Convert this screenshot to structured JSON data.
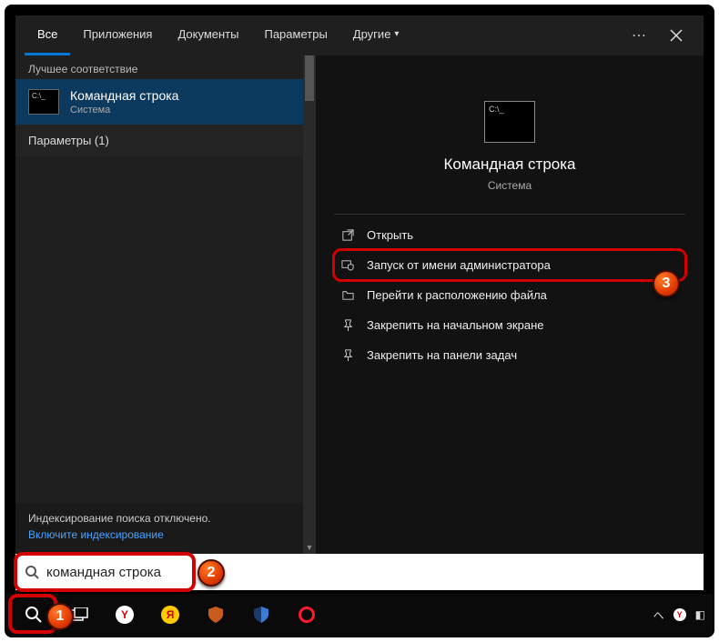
{
  "tabs": {
    "all": "Все",
    "apps": "Приложения",
    "docs": "Документы",
    "settings": "Параметры",
    "other": "Другие"
  },
  "left": {
    "best_match": "Лучшее соответствие",
    "result": {
      "title": "Командная строка",
      "sub": "Система"
    },
    "params": "Параметры (1)",
    "index_off": "Индексирование поиска отключено.",
    "index_link": "Включите индексирование"
  },
  "right": {
    "title": "Командная строка",
    "sub": "Система",
    "actions": {
      "open": "Открыть",
      "runas": "Запуск от имени администратора",
      "goto": "Перейти к расположению файла",
      "pin_start": "Закрепить на начальном экране",
      "pin_task": "Закрепить на панели задач"
    }
  },
  "search": {
    "value": "командная строка"
  },
  "badges": {
    "b1": "1",
    "b2": "2",
    "b3": "3"
  }
}
